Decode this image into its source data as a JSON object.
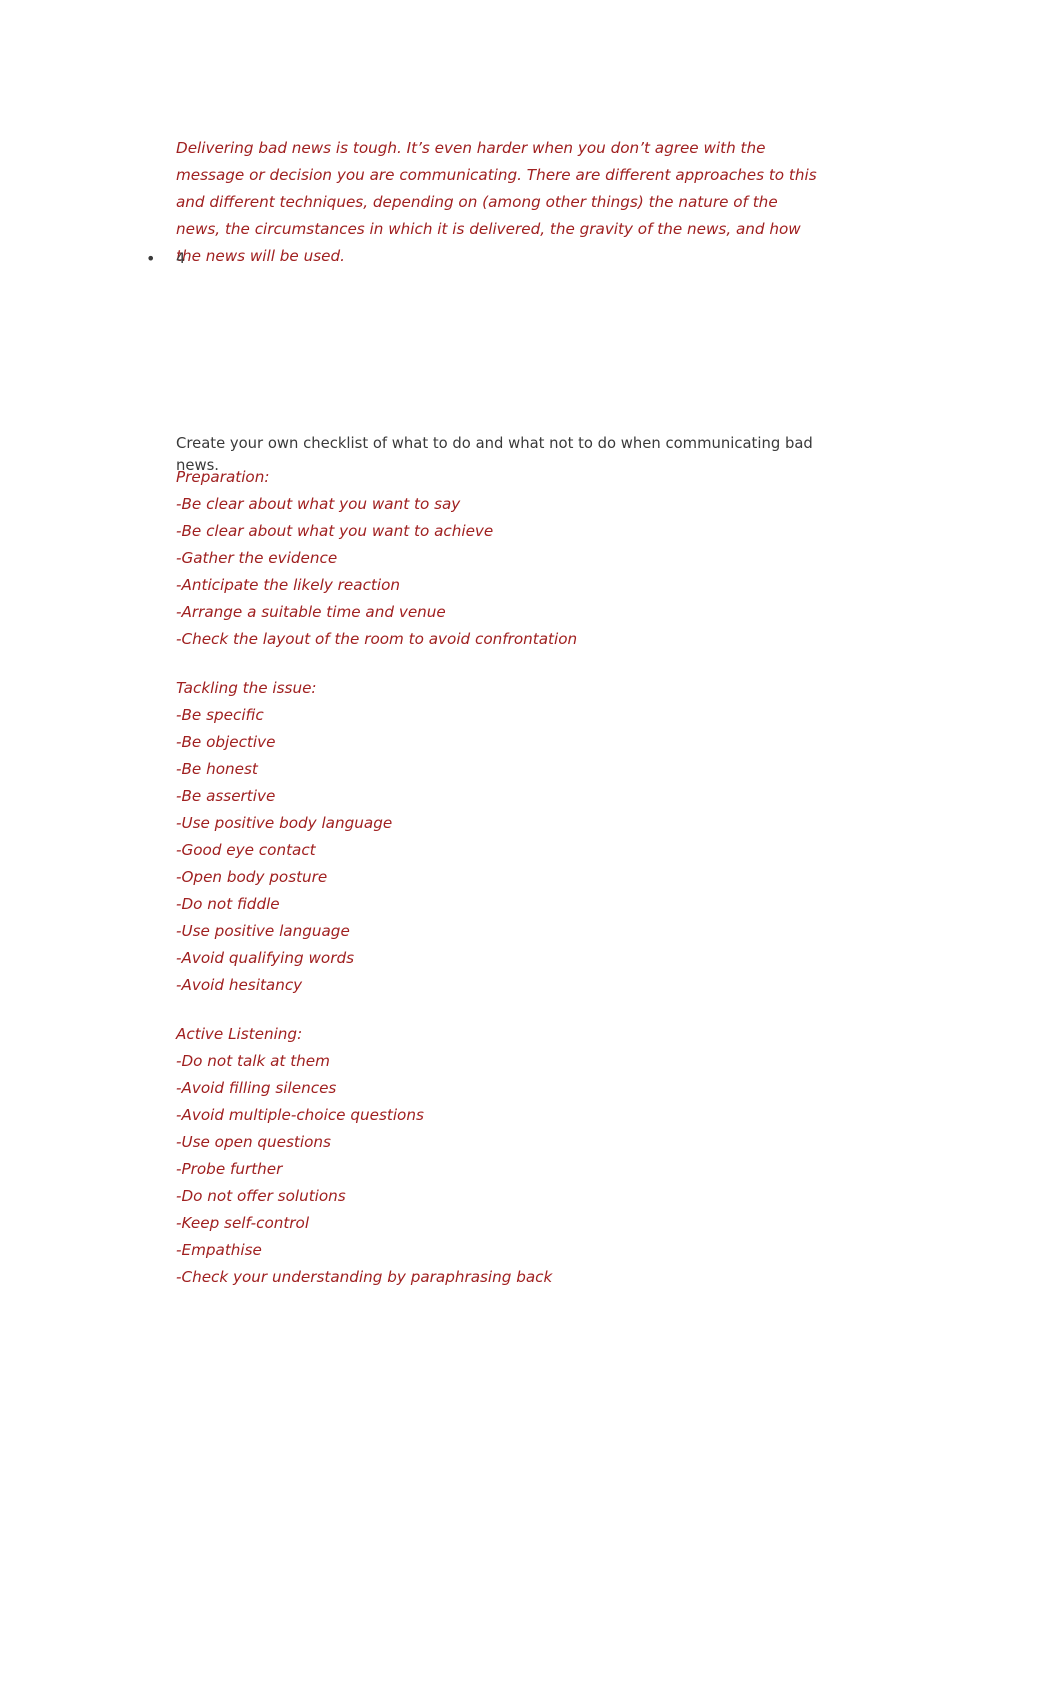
{
  "document": {
    "intro_paragraph": "Delivering bad news is tough. It’s even harder when you don’t agree with the message or decision you are communicating. There are different approaches to this and different techniques, depending on (among other things) the nature of the news, the circumstances in which it is delivered, the gravity of the news, and how the news will be used.",
    "bullet": {
      "marker": "•",
      "label": "4"
    },
    "instruction": "Create your own checklist of what to do and what not to do when communicating bad news.",
    "sections": [
      {
        "heading": "Preparation:",
        "items": [
          "-Be clear about what you want to say",
          "-Be clear about what you want to achieve",
          "-Gather the evidence",
          "-Anticipate the likely reaction",
          "-Arrange a suitable time and venue",
          "-Check the layout of the room to avoid confrontation"
        ]
      },
      {
        "heading": "Tackling the issue:",
        "items": [
          "-Be specific",
          "-Be objective",
          "-Be honest",
          "-Be assertive",
          "-Use positive body language",
          "-Good eye contact",
          "-Open body posture",
          "-Do not fiddle",
          "-Use positive language",
          "-Avoid qualifying words",
          "-Avoid hesitancy"
        ]
      },
      {
        "heading": "Active Listening:",
        "items": [
          "-Do not talk at them",
          "-Avoid filling silences",
          "-Avoid multiple-choice questions",
          "-Use open questions",
          "-Probe further",
          "-Do not offer solutions",
          "-Keep self-control",
          "-Empathise",
          "-Check your understanding by paraphrasing back"
        ]
      }
    ],
    "colors": {
      "accent_red": "#A02020",
      "body_gray": "#3a3a3a",
      "page_background": "#ffffff"
    }
  }
}
